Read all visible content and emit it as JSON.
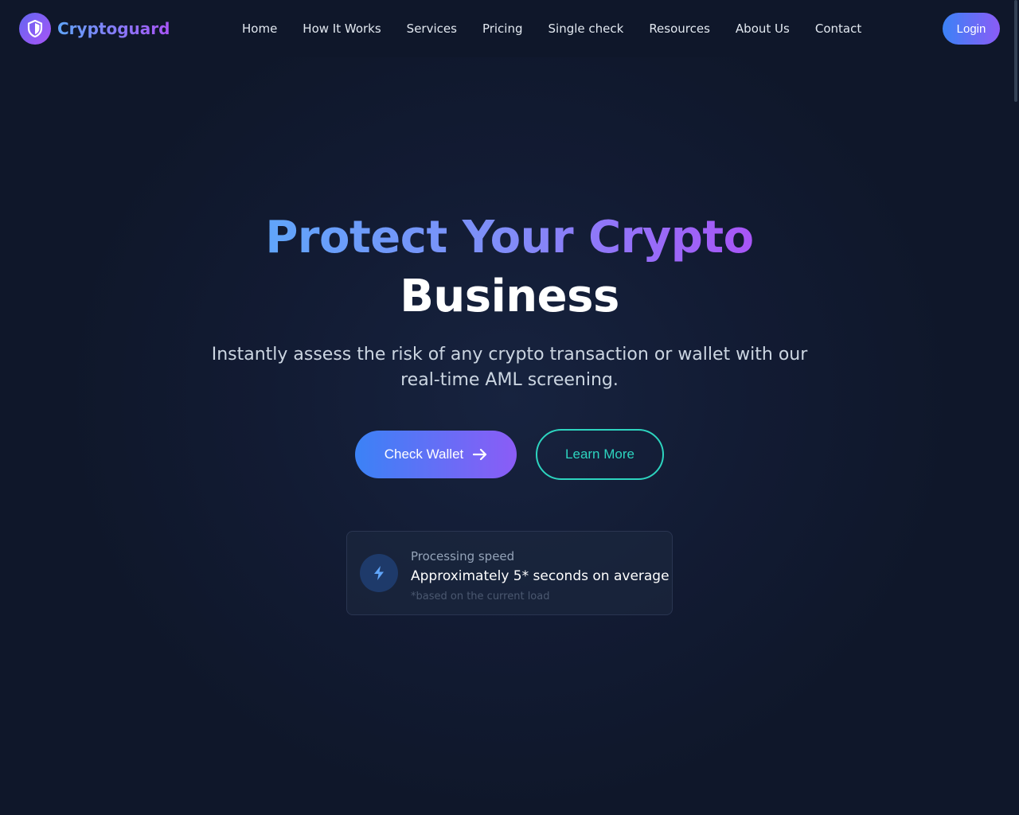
{
  "brand": {
    "name": "Cryptoguard",
    "logo_icon": "shield-icon"
  },
  "nav": {
    "items": [
      "Home",
      "How It Works",
      "Services",
      "Pricing",
      "Single check",
      "Resources",
      "About Us",
      "Contact"
    ],
    "login_label": "Login"
  },
  "hero": {
    "title_gradient": "Protect Your Crypto",
    "title_plain": "Business",
    "subtitle": "Instantly assess the risk of any crypto transaction or wallet with our real-time AML screening.",
    "primary_cta": "Check Wallet",
    "primary_cta_icon": "arrow-right-icon",
    "secondary_cta": "Learn More"
  },
  "speed_card": {
    "icon": "lightning-bolt-icon",
    "label": "Processing speed",
    "value": "Approximately 5* seconds on average",
    "note": "*based on the current load"
  },
  "colors": {
    "background": "#0f172a",
    "accent_blue": "#3b82f6",
    "accent_purple": "#8b5cf6",
    "accent_teal": "#2dd4bf"
  }
}
